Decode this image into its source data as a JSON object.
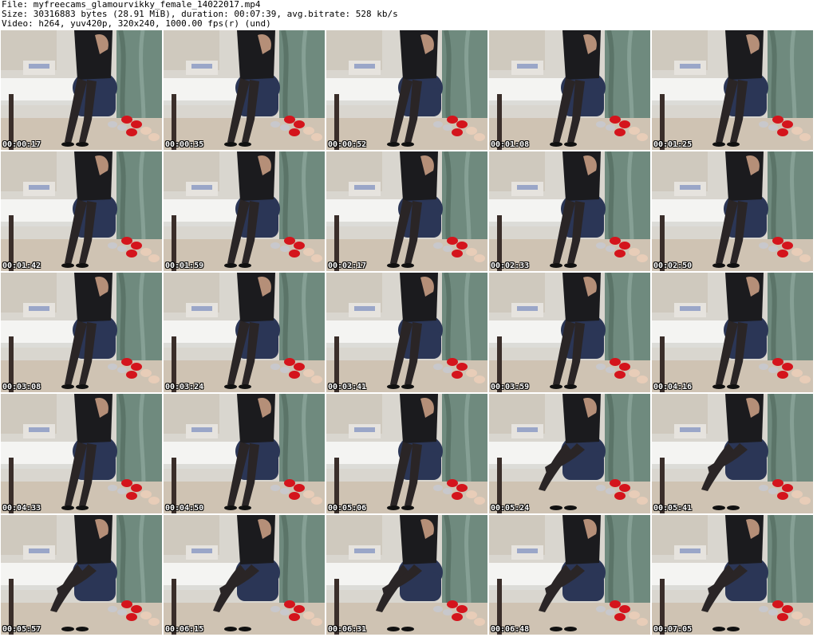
{
  "header": {
    "file_line": "File: myfreecams_glamourvikky_female_14022017.mp4",
    "size_line": "Size: 30316883 bytes (28.91 MiB), duration: 00:07:39, avg.bitrate: 528 kb/s",
    "video_line": "Video: h264, yuv420p, 320x240, 1000.00 fps(r) (und)"
  },
  "thumbnails": [
    "00:00:17",
    "00:00:35",
    "00:00:52",
    "00:01:08",
    "00:01:25",
    "00:01:42",
    "00:01:59",
    "00:02:17",
    "00:02:33",
    "00:02:50",
    "00:03:08",
    "00:03:24",
    "00:03:41",
    "00:03:59",
    "00:04:16",
    "00:04:33",
    "00:04:50",
    "00:05:06",
    "00:05:24",
    "00:05:41",
    "00:05:57",
    "00:06:15",
    "00:06:31",
    "00:06:48",
    "00:07:05"
  ],
  "colors": {
    "wall": "#d9d6cf",
    "curtain": "#6f8a7e",
    "table": "#f4f4f2",
    "floor": "#cfc3b3",
    "chair": "#2b3656",
    "dress": "#1b1b1e",
    "legs": "#2a2526",
    "shoe_red": "#d4141c",
    "shoe_silver": "#c8c8cc",
    "shoe_nude": "#e8cdb8"
  }
}
